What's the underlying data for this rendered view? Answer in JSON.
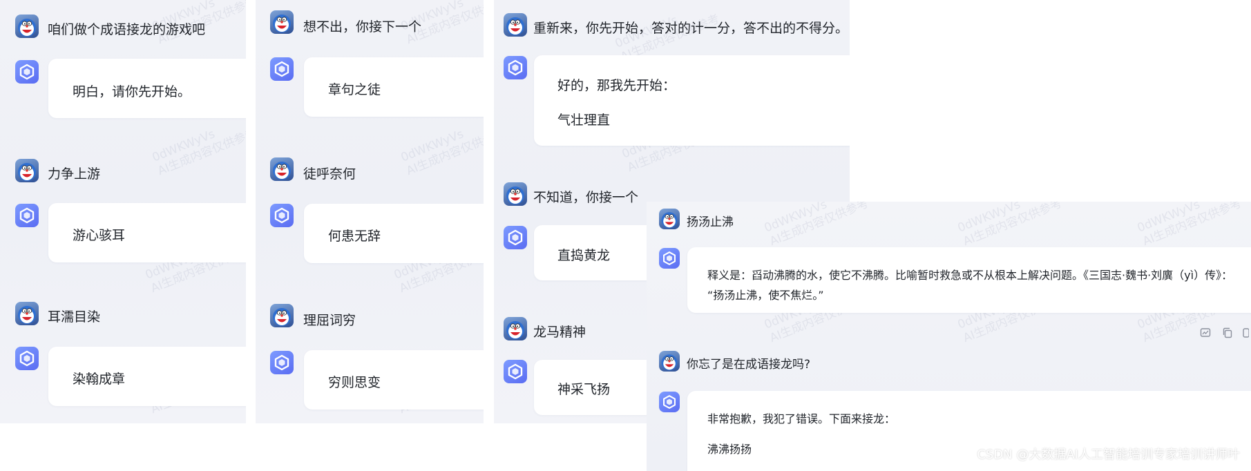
{
  "watermark": {
    "line1": "0dWKWyVs",
    "line2": "AI生成内容仅供参考"
  },
  "panel1": {
    "messages": [
      {
        "user": "咱们做个成语接龙的游戏吧",
        "bot": "明白，请你先开始。"
      },
      {
        "user": "力争上游",
        "bot": "游心骇耳"
      },
      {
        "user": "耳濡目染",
        "bot": "染翰成章"
      }
    ]
  },
  "panel2": {
    "messages": [
      {
        "user": "想不出，你接下一个",
        "bot": "章句之徒"
      },
      {
        "user": "徒呼奈何",
        "bot": "何患无辞"
      },
      {
        "user": "理屈词穷",
        "bot": "穷则思变"
      }
    ]
  },
  "panel3": {
    "first_user": "重新来，你先开始，答对的计一分，答不出的不得分。",
    "first_bot_line1": "好的，那我先开始：",
    "first_bot_line2": "气壮理直",
    "messages": [
      {
        "user": "不知道，你接一个",
        "bot": "直捣黄龙"
      },
      {
        "user": "龙马精神",
        "bot": "神采飞扬"
      }
    ]
  },
  "panel4": {
    "user1": "扬汤止沸",
    "bot1_line1": "释义是：舀动沸腾的水，使它不沸腾。比喻暂时救急或不从根本上解决问题。《三国志·魏书·刘廙（yì）传》：",
    "bot1_line2": "“扬汤止沸，使不焦烂。”",
    "user2": "你忘了是在成语接龙吗?",
    "bot2_line1": "非常抱歉，我犯了错误。下面来接龙：",
    "bot2_line2": "沸沸扬扬"
  },
  "credit": "CSDN @大数据AI人工智能培训专家培训讲师叶",
  "colors": {
    "panel_bg": "#f1f2f7",
    "bot_icon": "#6a7cf6",
    "bubble": "#ffffff"
  }
}
